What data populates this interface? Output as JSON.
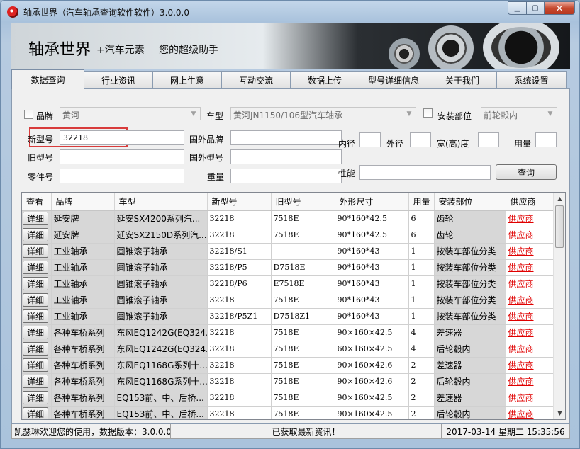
{
  "window": {
    "title": "轴承世界（汽车轴承查询软件软件）3.0.0.0"
  },
  "banner": {
    "main": "轴承世界",
    "sub": "+汽车元素",
    "sub2": "您的超级助手"
  },
  "tabs": [
    "数据查询",
    "行业资讯",
    "网上生意",
    "互动交流",
    "数据上传",
    "型号详细信息",
    "关于我们",
    "系统设置"
  ],
  "form": {
    "brand_label": "品牌",
    "brand_value": "黄河",
    "model_label": "车型",
    "model_value": "黄河JN1150/106型汽车轴承",
    "position_label": "安装部位",
    "position_value": "前轮毂内",
    "new_no_label": "新型号",
    "new_no_value": "32218",
    "foreign_brand_label": "国外品牌",
    "old_no_label": "旧型号",
    "foreign_no_label": "国外型号",
    "part_no_label": "零件号",
    "weight_label": "重量",
    "inner_label": "内径",
    "outer_label": "外径",
    "width_label": "宽(高)度",
    "usage_label": "用量",
    "perf_label": "性能",
    "query_button": "查询"
  },
  "table": {
    "headers": [
      "查看",
      "品牌",
      "车型",
      "新型号",
      "旧型号",
      "外形尺寸",
      "用量",
      "安装部位",
      "供应商"
    ],
    "detail_label": "详细",
    "supplier_label": "供应商",
    "rows": [
      [
        "延安牌",
        "延安SX4200系列汽...",
        "32218",
        "7518E",
        "90*160*42.5",
        "6",
        "齿轮"
      ],
      [
        "延安牌",
        "延安SX2150D系列汽...",
        "32218",
        "7518E",
        "90*160*42.5",
        "6",
        "齿轮"
      ],
      [
        "工业轴承",
        "圆锥滚子轴承",
        "32218/S1",
        "",
        "90*160*43",
        "1",
        "按装车部位分类"
      ],
      [
        "工业轴承",
        "圆锥滚子轴承",
        "32218/P5",
        "D7518E",
        "90*160*43",
        "1",
        "按装车部位分类"
      ],
      [
        "工业轴承",
        "圆锥滚子轴承",
        "32218/P6",
        "E7518E",
        "90*160*43",
        "1",
        "按装车部位分类"
      ],
      [
        "工业轴承",
        "圆锥滚子轴承",
        "32218",
        "7518E",
        "90*160*43",
        "1",
        "按装车部位分类"
      ],
      [
        "工业轴承",
        "圆锥滚子轴承",
        "32218/P5Z1",
        "D7518Z1",
        "90*160*43",
        "1",
        "按装车部位分类"
      ],
      [
        "各种车桥系列",
        "东风EQ1242G(EQ324...",
        "32218",
        "7518E",
        "90×160×42.5",
        "4",
        "差速器"
      ],
      [
        "各种车桥系列",
        "东风EQ1242G(EQ324...",
        "32218",
        "7518E",
        "60×160×42.5",
        "4",
        "后轮毂内"
      ],
      [
        "各种车桥系列",
        "东风EQ1168G系列十...",
        "32218",
        "7518E",
        "90×160×42.6",
        "2",
        "差速器"
      ],
      [
        "各种车桥系列",
        "东风EQ1168G系列十...",
        "32218",
        "7518E",
        "90×160×42.6",
        "2",
        "后轮毂内"
      ],
      [
        "各种车桥系列",
        "EQ153前、中、后桥...",
        "32218",
        "7518E",
        "90×160×42.5",
        "2",
        "差速器"
      ],
      [
        "各种车桥系列",
        "EQ153前、中、后桥...",
        "32218",
        "7518E",
        "90×160×42.5",
        "2",
        "后轮毂内"
      ]
    ]
  },
  "status": {
    "welcome": "凯瑟琳欢迎您的使用，数据版本：3.0.0.0",
    "message": "已获取最新资讯！",
    "datetime": "2017-03-14 星期二 15:35:56"
  },
  "colors": {
    "highlight": "#d83b3b",
    "supplier_link": "#e00000"
  }
}
